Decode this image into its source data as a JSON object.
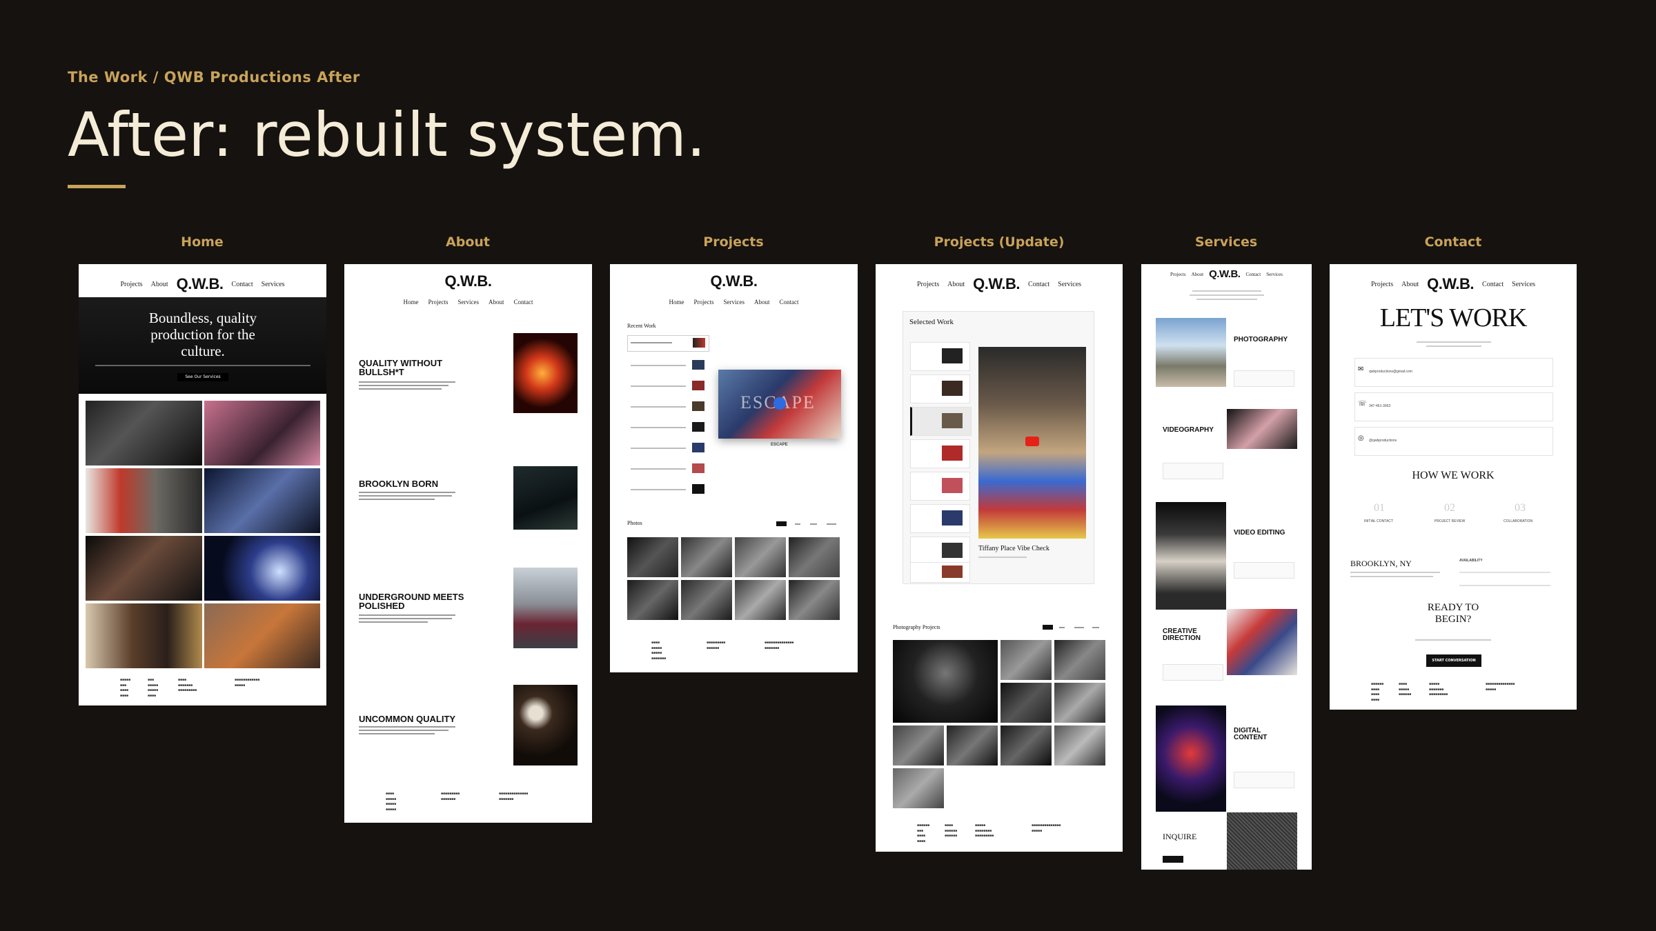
{
  "header": {
    "eyebrow": "The Work / QWB Productions After",
    "title": "After: rebuilt system."
  },
  "colors": {
    "background": "#15120f",
    "accent": "#c9a35a",
    "title": "#f5ecd8"
  },
  "columns": [
    "Home",
    "About",
    "Projects",
    "Projects (Update)",
    "Services",
    "Contact"
  ],
  "site": {
    "logo": "Q.W.B.",
    "nav_split": [
      "Projects",
      "About",
      "Contact",
      "Services"
    ],
    "nav_row": [
      "Home",
      "Projects",
      "Services",
      "About",
      "Contact"
    ]
  },
  "home": {
    "hero": "Boundless, quality production for the culture.",
    "cta": "See Our Services"
  },
  "about": {
    "sections": [
      "QUALITY WITHOUT BULLSH*T",
      "BROOKLYN BORN",
      "UNDERGROUND MEETS POLISHED",
      "UNCOMMON QUALITY"
    ]
  },
  "projects": {
    "list_heading": "Recent Work",
    "featured_caption": "ESCAPE",
    "video_overlay": "ESCAPE",
    "photos_heading": "Photos"
  },
  "projects_update": {
    "selected_heading": "Selected Work",
    "video_title": "Tiffany Place Vibe Check",
    "photo_heading": "Photography Projects"
  },
  "services": {
    "items": [
      "PHOTOGRAPHY",
      "VIDEOGRAPHY",
      "VIDEO EDITING",
      "CREATIVE DIRECTION",
      "DIGITAL CONTENT"
    ],
    "inquire": "INQUIRE"
  },
  "contact": {
    "heading": "LET'S WORK",
    "email": "qwbproductions@gmail.com",
    "phone": "347-461-3063",
    "instagram": "@qwbproductions",
    "how_heading": "HOW WE WORK",
    "steps": [
      "01",
      "02",
      "03"
    ],
    "step_labels": [
      "INITIAL CONTACT",
      "PROJECT REVIEW",
      "COLLABORATION"
    ],
    "location": "BROOKLYN, NY",
    "availability": "AVAILABILITY",
    "ready": "READY TO BEGIN?",
    "cta": "START CONVERSATION"
  }
}
